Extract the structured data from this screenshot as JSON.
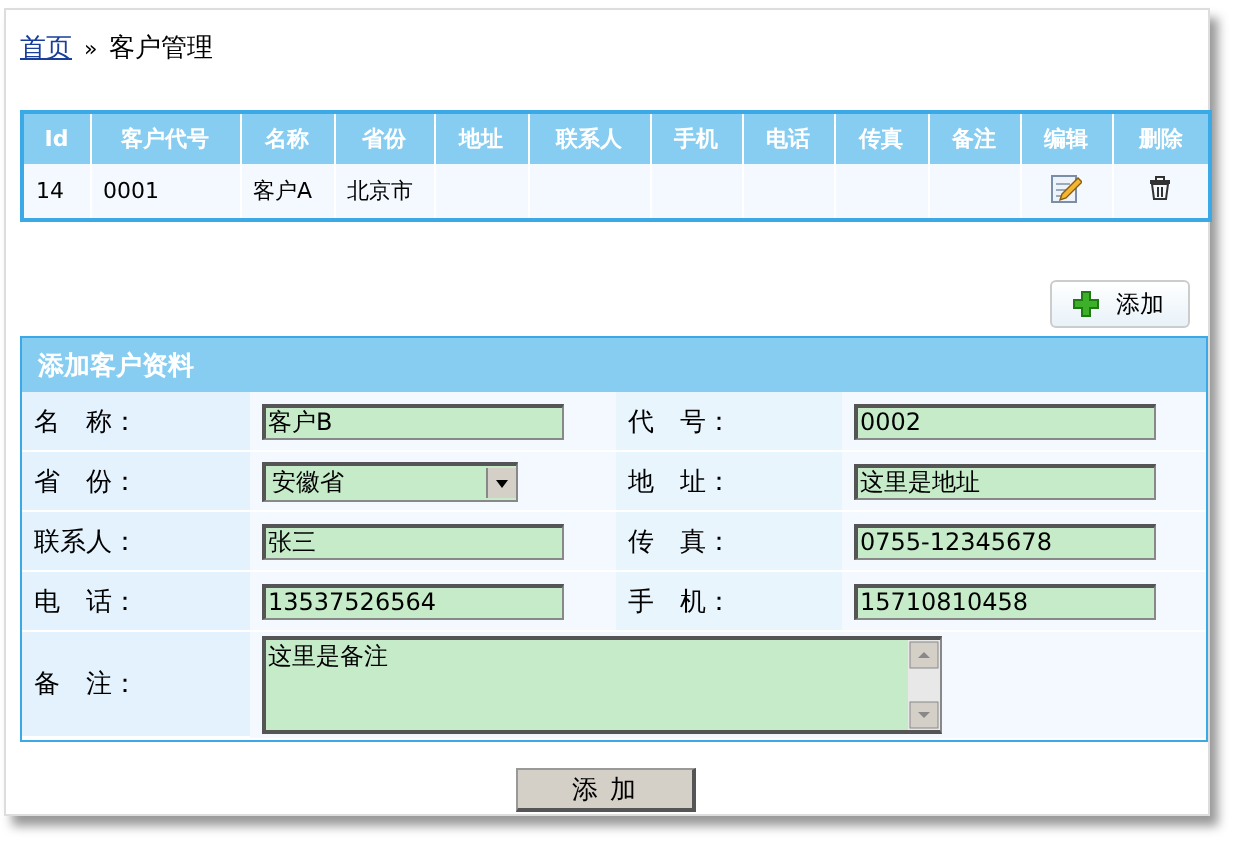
{
  "breadcrumb": {
    "home": "首页",
    "separator": "»",
    "current": "客户管理"
  },
  "table": {
    "columns": [
      "Id",
      "客户代号",
      "名称",
      "省份",
      "地址",
      "联系人",
      "手机",
      "电话",
      "传真",
      "备注",
      "编辑",
      "删除"
    ],
    "rows": [
      {
        "cells": [
          "14",
          "0001",
          "客户A",
          "北京市",
          "",
          "",
          "",
          "",
          "",
          ""
        ]
      }
    ]
  },
  "add_button": "添加",
  "form": {
    "title": "添加客户资料",
    "fields": [
      {
        "label": "名　称：",
        "kind": "text",
        "value": "客户B"
      },
      {
        "label": "代　号：",
        "kind": "text",
        "value": "0002"
      },
      {
        "label": "省　份：",
        "kind": "select",
        "value": "安徽省"
      },
      {
        "label": "地　址：",
        "kind": "text",
        "value": "这里是地址"
      },
      {
        "label": "联系人：",
        "kind": "text",
        "value": "张三"
      },
      {
        "label": "传　真：",
        "kind": "text",
        "value": "0755-12345678"
      },
      {
        "label": "电　话：",
        "kind": "text",
        "value": "13537526564"
      },
      {
        "label": "手　机：",
        "kind": "text",
        "value": "15710810458"
      },
      {
        "label": "备　注：",
        "kind": "textarea",
        "value": "这里是备注"
      }
    ]
  },
  "submit_button": "添 加"
}
